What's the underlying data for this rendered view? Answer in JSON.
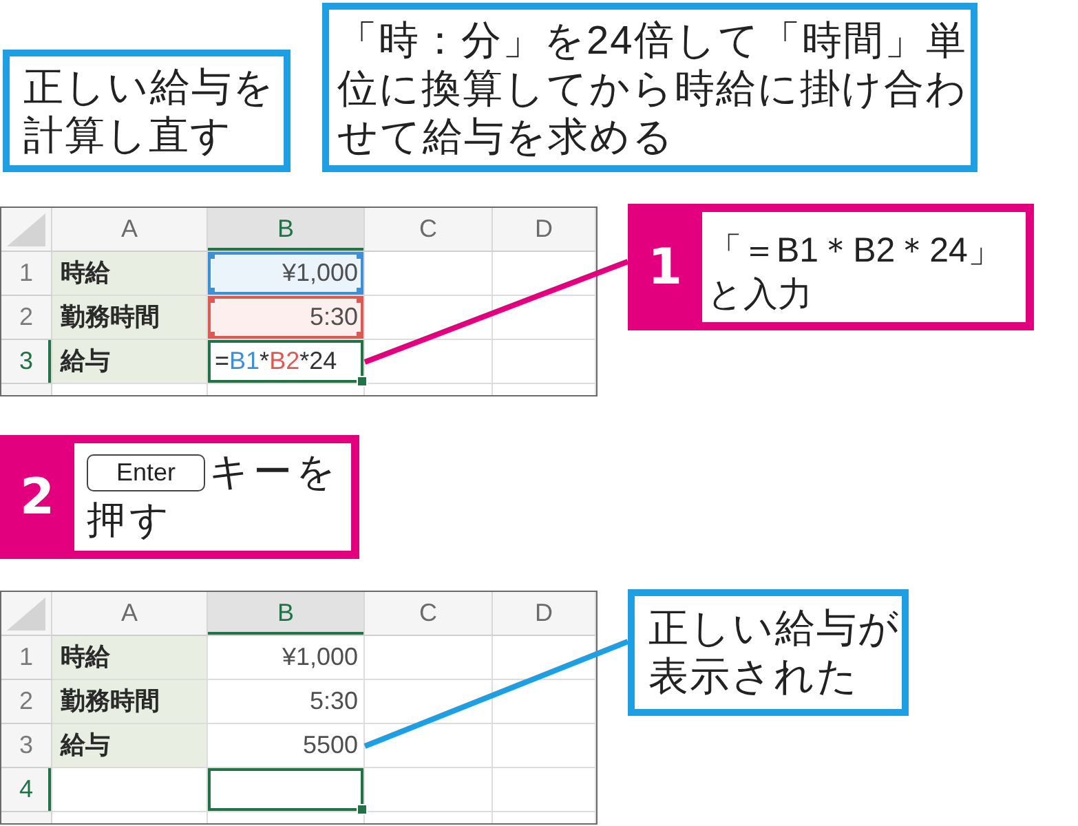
{
  "notes": [
    {
      "text": "正しい給与を計算し直す"
    },
    {
      "text": "「時：分」を24倍して「時間」単位に換算してから時給に掛け合わせて給与を求める"
    }
  ],
  "sheets": [
    {
      "columns": [
        {
          "label": "A",
          "selected": false
        },
        {
          "label": "B",
          "selected": true
        },
        {
          "label": "C",
          "selected": false
        },
        {
          "label": "D",
          "selected": false
        }
      ],
      "rows": [
        {
          "label": "1",
          "selected": false,
          "cells": [
            {
              "kind": "label",
              "text": "時給",
              "selected": false
            },
            {
              "kind": "number",
              "text": "¥1,000",
              "selected": false,
              "color": "#3d8fd6"
            },
            {
              "kind": "blank",
              "selected": false
            },
            {
              "kind": "blank",
              "selected": false
            }
          ]
        },
        {
          "label": "2",
          "selected": false,
          "cells": [
            {
              "kind": "label",
              "text": "勤務時間",
              "selected": false
            },
            {
              "kind": "number",
              "text": "5:30",
              "selected": false,
              "color": "#dc5a52"
            },
            {
              "kind": "blank",
              "selected": false
            },
            {
              "kind": "blank",
              "selected": false
            }
          ]
        },
        {
          "label": "3",
          "selected": true,
          "cells": [
            {
              "kind": "label",
              "text": "給与",
              "selected": false
            },
            {
              "kind": "formula",
              "selected": true,
              "tokens": [
                {
                  "text": "=",
                  "color": "#333333"
                },
                {
                  "text": "B1",
                  "color": "#3d8fd6"
                },
                {
                  "text": "*",
                  "color": "#333333"
                },
                {
                  "text": "B2",
                  "color": "#dc5a52"
                },
                {
                  "text": "*24",
                  "color": "#333333"
                }
              ]
            },
            {
              "kind": "blank",
              "selected": false
            },
            {
              "kind": "blank",
              "selected": false
            }
          ]
        }
      ]
    },
    {
      "columns": [
        {
          "label": "A",
          "selected": false
        },
        {
          "label": "B",
          "selected": true
        },
        {
          "label": "C",
          "selected": false
        },
        {
          "label": "D",
          "selected": false
        }
      ],
      "rows": [
        {
          "label": "1",
          "selected": false,
          "cells": [
            {
              "kind": "label",
              "text": "時給",
              "selected": false
            },
            {
              "kind": "number",
              "text": "¥1,000",
              "selected": false
            },
            {
              "kind": "blank",
              "selected": false
            },
            {
              "kind": "blank",
              "selected": false
            }
          ]
        },
        {
          "label": "2",
          "selected": false,
          "cells": [
            {
              "kind": "label",
              "text": "勤務時間",
              "selected": false
            },
            {
              "kind": "number",
              "text": "5:30",
              "selected": false
            },
            {
              "kind": "blank",
              "selected": false
            },
            {
              "kind": "blank",
              "selected": false
            }
          ]
        },
        {
          "label": "3",
          "selected": false,
          "cells": [
            {
              "kind": "label",
              "text": "給与",
              "selected": false
            },
            {
              "kind": "number",
              "text": "5500",
              "selected": false
            },
            {
              "kind": "blank",
              "selected": false
            },
            {
              "kind": "blank",
              "selected": false
            }
          ]
        },
        {
          "label": "4",
          "selected": true,
          "cells": [
            {
              "kind": "blank",
              "selected": false
            },
            {
              "kind": "blank",
              "selected": true
            },
            {
              "kind": "blank",
              "selected": false
            },
            {
              "kind": "blank",
              "selected": false
            }
          ]
        }
      ]
    }
  ],
  "steps": [
    {
      "number": "1",
      "text": "「＝B1＊B2＊24」と入力"
    },
    {
      "number": "2",
      "key": "Enter",
      "text": "キーを押す"
    }
  ],
  "result_note": {
    "text": "正しい給与が表示された"
  }
}
